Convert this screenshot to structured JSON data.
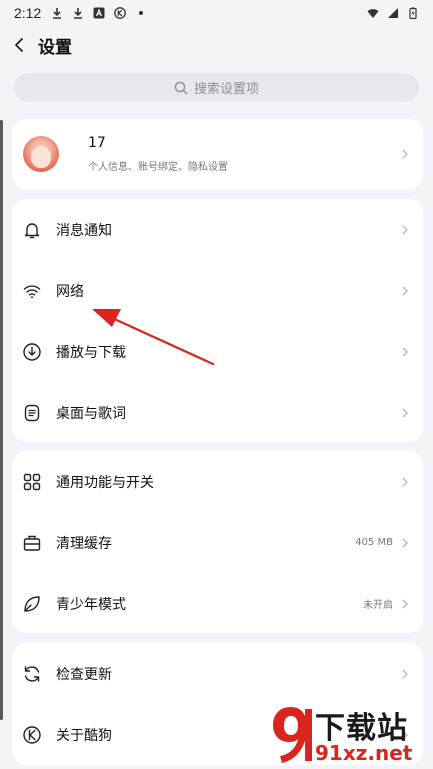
{
  "status_bar": {
    "time": "2:12",
    "left_icons": [
      "download-icon",
      "download-icon",
      "app-a-icon",
      "app-k-icon",
      "dot-icon"
    ],
    "right_icons": [
      "wifi-icon",
      "signal-icon",
      "battery-charging-icon"
    ]
  },
  "header": {
    "title": "设置",
    "back_icon": "back-arrow-icon"
  },
  "search": {
    "placeholder": "搜索设置项"
  },
  "profile": {
    "name": "17",
    "subtitle": "个人信息、账号绑定、隐私设置"
  },
  "group1": [
    {
      "label": "消息通知",
      "icon": "bell-icon"
    },
    {
      "label": "网络",
      "icon": "wifi-icon"
    },
    {
      "label": "播放与下载",
      "icon": "download-circle-icon"
    },
    {
      "label": "桌面与歌词",
      "icon": "lyrics-icon"
    }
  ],
  "group2": [
    {
      "label": "通用功能与开关",
      "icon": "grid-icon",
      "value": ""
    },
    {
      "label": "清理缓存",
      "icon": "briefcase-icon",
      "value": "405 MB"
    },
    {
      "label": "青少年模式",
      "icon": "leaf-icon",
      "value": "未开启"
    }
  ],
  "group3": [
    {
      "label": "检查更新",
      "icon": "refresh-icon"
    },
    {
      "label": "关于酷狗",
      "icon": "kugou-logo-icon"
    }
  ],
  "watermark": {
    "brand": "下载站",
    "url": "91xz.net"
  },
  "colors": {
    "background": "#f3f4f8",
    "card": "#ffffff",
    "annotation": "#d8261f"
  }
}
